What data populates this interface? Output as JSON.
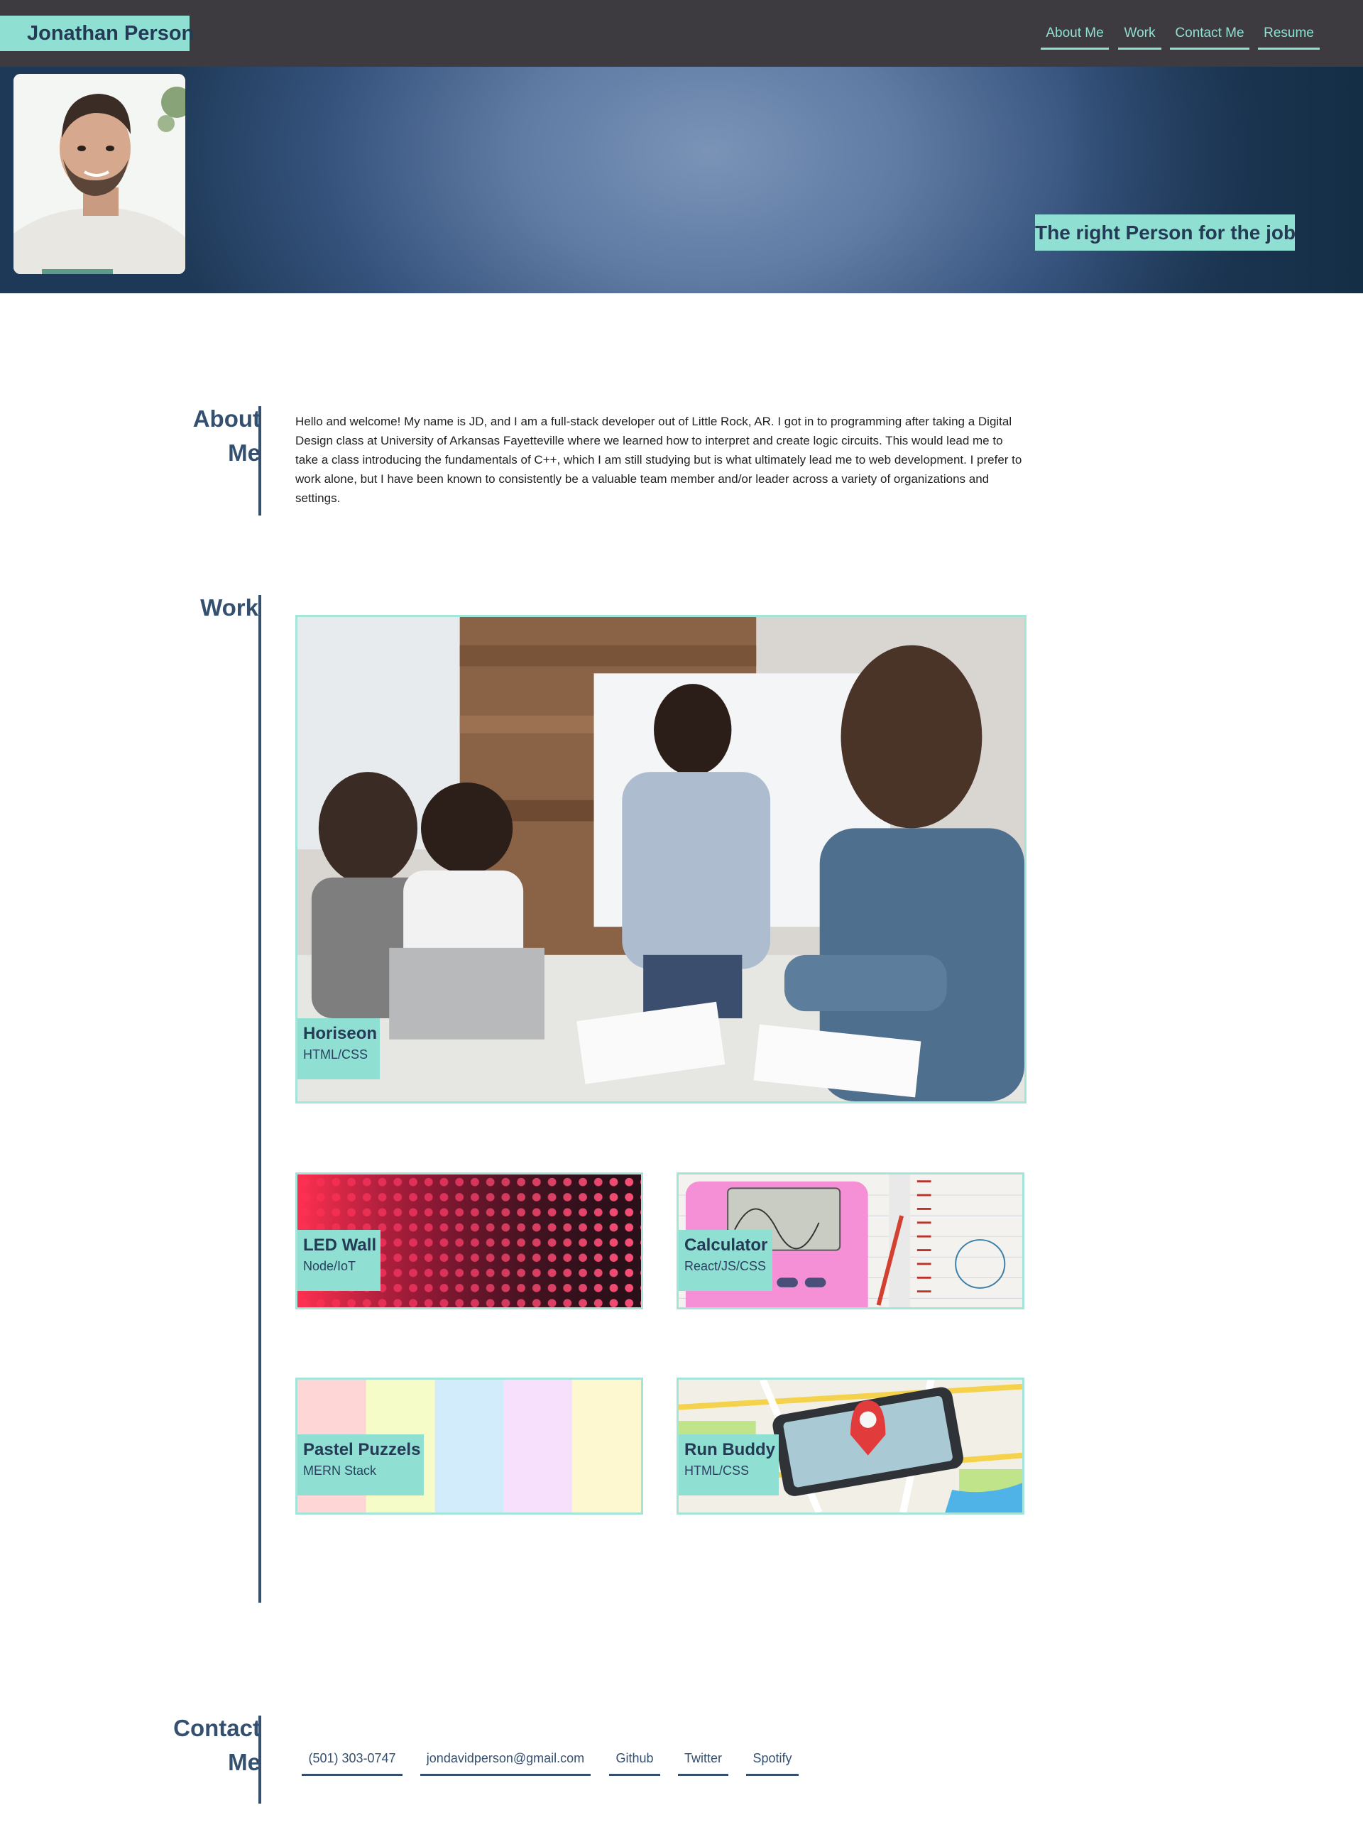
{
  "header": {
    "site_name": "Jonathan Person",
    "nav": [
      "About Me",
      "Work",
      "Contact Me",
      "Resume"
    ]
  },
  "hero": {
    "tagline": "The right Person for the job"
  },
  "about": {
    "title": "About Me",
    "text": "Hello and welcome! My name is JD, and I am a full-stack developer out of Little Rock, AR. I got in to programming after taking a Digital Design class at University of Arkansas Fayetteville where we learned how to interpret and create logic circuits. This would lead me to take a class introducing the fundamentals of C++, which I am still studying but is what ultimately lead me to web development. I prefer to work alone, but I have been known to consistently be a valuable team member and/or leader across a variety of organizations and settings."
  },
  "work": {
    "title": "Work",
    "projects": [
      {
        "name": "Horiseon",
        "stack": "HTML/CSS"
      },
      {
        "name": "LED Wall",
        "stack": "Node/IoT"
      },
      {
        "name": "Calculator",
        "stack": "React/JS/CSS"
      },
      {
        "name": "Pastel Puzzels",
        "stack": "MERN Stack"
      },
      {
        "name": "Run Buddy",
        "stack": "HTML/CSS"
      }
    ]
  },
  "contact": {
    "title": "Contact Me",
    "links": [
      "(501) 303-0747",
      "jondavidperson@gmail.com",
      "Github",
      "Twitter",
      "Spotify"
    ]
  },
  "colors": {
    "accent": "#8fe0d3",
    "header_bg": "#3d3b40",
    "heading": "#35506f",
    "card_border": "#a4e4d9"
  }
}
